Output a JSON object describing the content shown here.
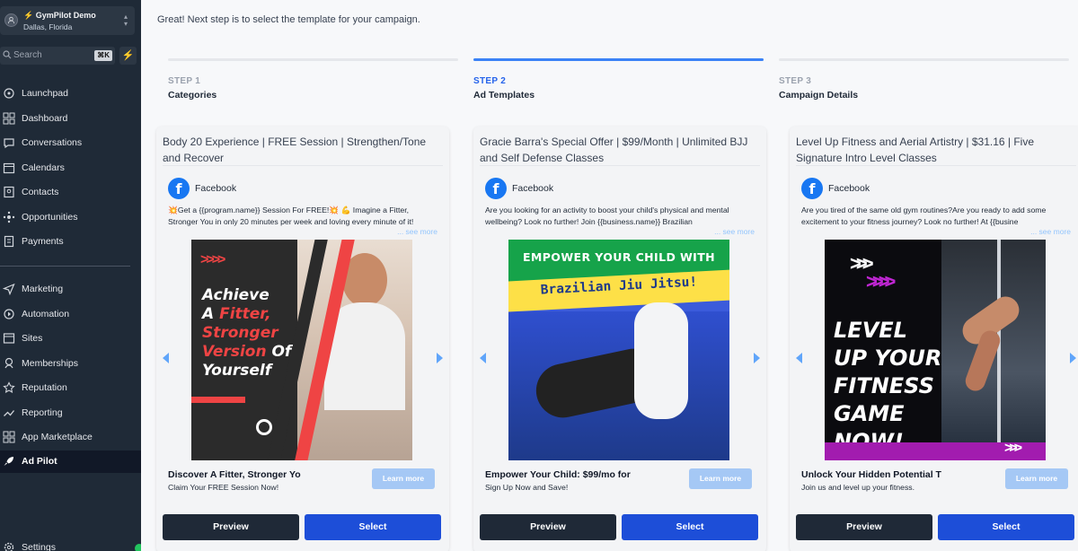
{
  "account": {
    "name": "⚡ GymPilot Demo",
    "location": "Dallas, Florida"
  },
  "search": {
    "placeholder": "Search",
    "shortcut": "⌘K"
  },
  "sidebar": {
    "items": [
      {
        "label": "Launchpad",
        "icon": "rocket-icon"
      },
      {
        "label": "Dashboard",
        "icon": "grid-icon"
      },
      {
        "label": "Conversations",
        "icon": "chat-icon"
      },
      {
        "label": "Calendars",
        "icon": "calendar-icon"
      },
      {
        "label": "Contacts",
        "icon": "contacts-icon"
      },
      {
        "label": "Opportunities",
        "icon": "opportunities-icon"
      },
      {
        "label": "Payments",
        "icon": "payments-icon"
      },
      {
        "label": "Marketing",
        "icon": "send-icon"
      },
      {
        "label": "Automation",
        "icon": "automation-icon"
      },
      {
        "label": "Sites",
        "icon": "sites-icon"
      },
      {
        "label": "Memberships",
        "icon": "memberships-icon"
      },
      {
        "label": "Reputation",
        "icon": "star-icon"
      },
      {
        "label": "Reporting",
        "icon": "chart-icon"
      },
      {
        "label": "App Marketplace",
        "icon": "apps-icon"
      },
      {
        "label": "Ad Pilot",
        "icon": "rocket-icon"
      },
      {
        "label": "Settings",
        "icon": "gear-icon"
      }
    ]
  },
  "main": {
    "intro": "Great! Next step is to select the template for your campaign.",
    "steps": [
      {
        "num": "STEP 1",
        "title": "Categories"
      },
      {
        "num": "STEP 2",
        "title": "Ad Templates"
      },
      {
        "num": "STEP 3",
        "title": "Campaign Details"
      }
    ],
    "cards": [
      {
        "title": "Body 20 Experience | FREE Session | Strengthen/Tone and Recover",
        "platform": "Facebook",
        "body": "💥Get a {{program.name}} Session For FREE!💥 💪 Imagine a Fitter, Stronger You in only 20 minutes per week and loving every minute of it!",
        "see_more": "... see more",
        "creative": {
          "line1": "Achieve",
          "line2a": "A ",
          "line2b": "Fitter,",
          "line3": "Stronger",
          "line4a": "Version",
          "line4b": " Of",
          "line5": "Yourself"
        },
        "headline": "Discover A Fitter, Stronger Yo",
        "description": "Claim Your FREE Session Now!",
        "cta": "Learn more",
        "preview": "Preview",
        "select": "Select"
      },
      {
        "title": "Gracie Barra's Special Offer | $99/Month | Unlimited BJJ and Self Defense Classes",
        "platform": "Facebook",
        "body": "Are you looking for an activity to boost your child's physical and mental wellbeing? Look no further! Join {{business.name}} Brazilian",
        "see_more": "... see more",
        "creative": {
          "line1": "EMPOWER YOUR CHILD WITH",
          "line2": "Brazilian Jiu Jitsu!"
        },
        "headline": "Empower Your Child: $99/mo for",
        "description": "Sign Up Now and Save!",
        "cta": "Learn more",
        "preview": "Preview",
        "select": "Select"
      },
      {
        "title": "Level Up Fitness and Aerial Artistry | $31.16 | Five Signature Intro Level Classes",
        "platform": "Facebook",
        "body": "Are you tired of the same old gym routines?Are you ready to add some excitement to your fitness journey? Look no further! At {{busine",
        "see_more": "... see more",
        "creative": {
          "line1": "LEVEL",
          "line2": "UP YOUR",
          "line3": "FITNESS",
          "line4": "GAME NOW!"
        },
        "headline": "Unlock Your Hidden Potential T",
        "description": "Join us and level up your fitness.",
        "cta": "Learn more",
        "preview": "Preview",
        "select": "Select"
      }
    ]
  },
  "colors": {
    "sidebar_bg": "#1f2a37",
    "accent": "#1d4ed8",
    "step_active": "#3b82f6",
    "facebook": "#1877f2"
  }
}
